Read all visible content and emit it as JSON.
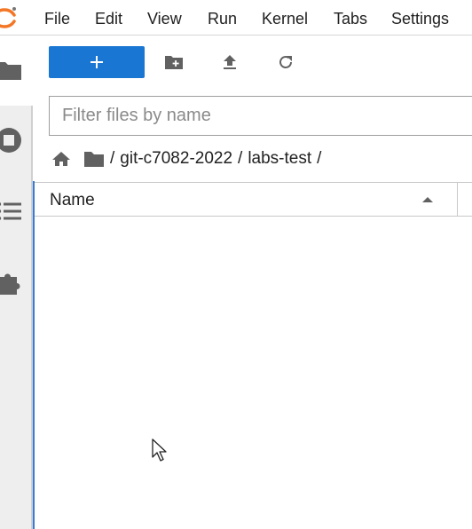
{
  "menubar": {
    "items": [
      "File",
      "Edit",
      "View",
      "Run",
      "Kernel",
      "Tabs",
      "Settings"
    ]
  },
  "toolbar": {
    "new_label": "+",
    "new_folder_icon": "new-folder-icon",
    "upload_icon": "upload-icon",
    "refresh_icon": "refresh-icon"
  },
  "filter": {
    "placeholder": "Filter files by name",
    "value": ""
  },
  "breadcrumb": {
    "separator": "/",
    "segments": [
      "git-c7082-2022",
      "labs-test"
    ],
    "trailing": "/"
  },
  "list": {
    "column_name": "Name",
    "sort": "ascending",
    "rows": []
  },
  "rail": {
    "icons": [
      "folder-icon",
      "running-icon",
      "toc-icon",
      "extension-icon"
    ]
  },
  "colors": {
    "accent": "#1976d2",
    "logo": "#f37726",
    "rail_background": "#eeeeee",
    "icon": "#616161"
  }
}
